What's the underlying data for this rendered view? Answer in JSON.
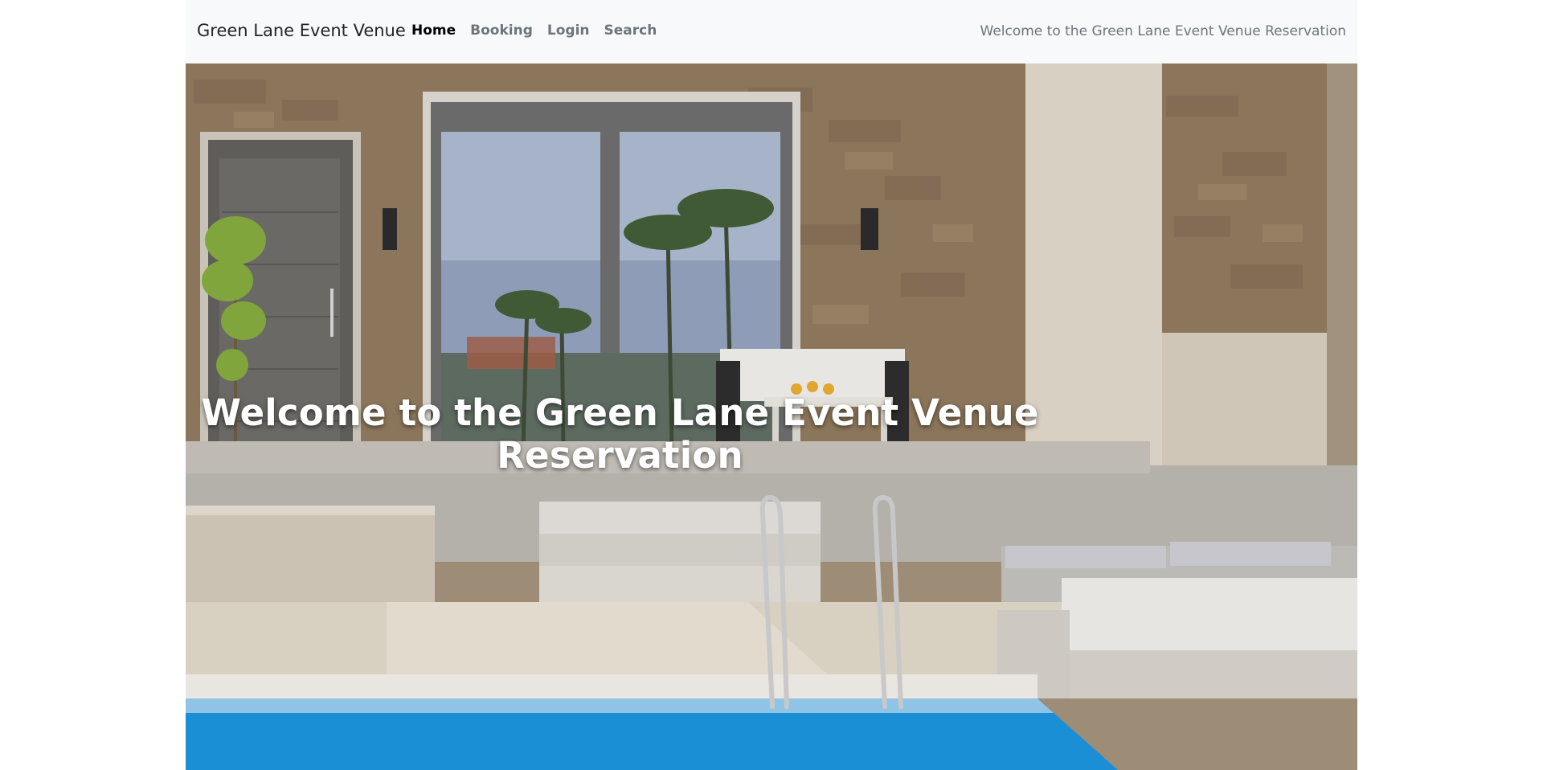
{
  "navbar": {
    "brand": "Green Lane Event Venue",
    "links": [
      {
        "label": "Home",
        "active": true
      },
      {
        "label": "Booking",
        "active": false
      },
      {
        "label": "Login",
        "active": false
      },
      {
        "label": "Search",
        "active": false
      }
    ],
    "right_text": "Welcome to the Green Lane Event Venue Reservation"
  },
  "hero": {
    "title": "Welcome to the Green Lane Event Venue Reservation",
    "image_description": "villa-patio-with-pool"
  },
  "colors": {
    "navbar_bg": "#f8f9fa",
    "active_link": "#000000",
    "muted_link": "#6c757d",
    "pool_blue": "#1a8fd6",
    "stone_wall": "#8a7359"
  }
}
